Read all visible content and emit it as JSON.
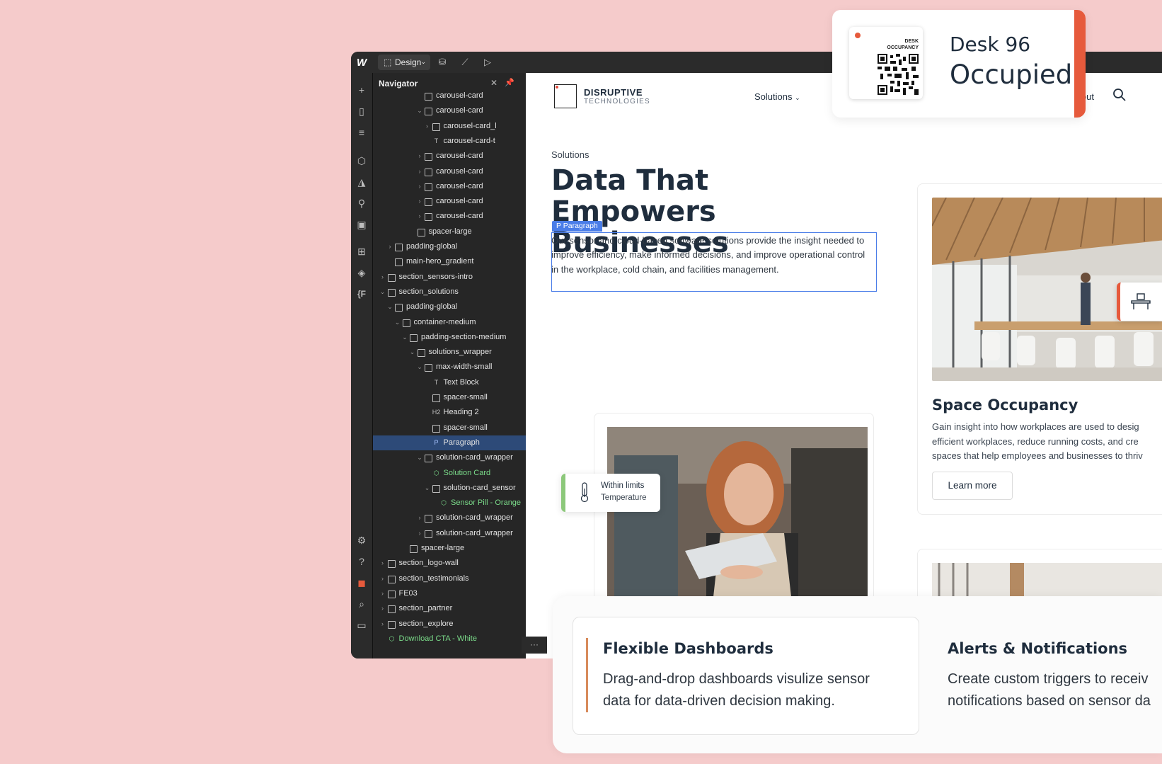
{
  "editor": {
    "mode_label": "Design",
    "navigator": {
      "title": "Navigator",
      "tree": [
        {
          "label": "carousel-card",
          "depth": 6,
          "arrow": "",
          "icon": "box"
        },
        {
          "label": "carousel-card",
          "depth": 6,
          "arrow": "⌄",
          "icon": "box"
        },
        {
          "label": "carousel-card_l",
          "depth": 7,
          "arrow": "›",
          "icon": "box"
        },
        {
          "label": "carousel-card-t",
          "depth": 7,
          "arrow": "",
          "icon": "T"
        },
        {
          "label": "carousel-card",
          "depth": 6,
          "arrow": "›",
          "icon": "box"
        },
        {
          "label": "carousel-card",
          "depth": 6,
          "arrow": "›",
          "icon": "box"
        },
        {
          "label": "carousel-card",
          "depth": 6,
          "arrow": "›",
          "icon": "box"
        },
        {
          "label": "carousel-card",
          "depth": 6,
          "arrow": "›",
          "icon": "box"
        },
        {
          "label": "carousel-card",
          "depth": 6,
          "arrow": "›",
          "icon": "box"
        },
        {
          "label": "spacer-large",
          "depth": 5,
          "arrow": "",
          "icon": "box"
        },
        {
          "label": "padding-global",
          "depth": 2,
          "arrow": "›",
          "icon": "box"
        },
        {
          "label": "main-hero_gradient",
          "depth": 2,
          "arrow": "",
          "icon": "box"
        },
        {
          "label": "section_sensors-intro",
          "depth": 1,
          "arrow": "›",
          "icon": "box"
        },
        {
          "label": "section_solutions",
          "depth": 1,
          "arrow": "⌄",
          "icon": "box"
        },
        {
          "label": "padding-global",
          "depth": 2,
          "arrow": "⌄",
          "icon": "box"
        },
        {
          "label": "container-medium",
          "depth": 3,
          "arrow": "⌄",
          "icon": "box"
        },
        {
          "label": "padding-section-medium",
          "depth": 4,
          "arrow": "⌄",
          "icon": "box"
        },
        {
          "label": "solutions_wrapper",
          "depth": 5,
          "arrow": "⌄",
          "icon": "box"
        },
        {
          "label": "max-width-small",
          "depth": 6,
          "arrow": "⌄",
          "icon": "box"
        },
        {
          "label": "Text Block",
          "depth": 7,
          "arrow": "",
          "icon": "T"
        },
        {
          "label": "spacer-small",
          "depth": 7,
          "arrow": "",
          "icon": "box"
        },
        {
          "label": "Heading 2",
          "depth": 7,
          "arrow": "",
          "icon": "H2"
        },
        {
          "label": "spacer-small",
          "depth": 7,
          "arrow": "",
          "icon": "box"
        },
        {
          "label": "Paragraph",
          "depth": 7,
          "arrow": "",
          "icon": "P",
          "selected": true
        },
        {
          "label": "solution-card_wrapper",
          "depth": 6,
          "arrow": "⌄",
          "icon": "box"
        },
        {
          "label": "Solution Card",
          "depth": 7,
          "arrow": "",
          "icon": "comp",
          "component": true
        },
        {
          "label": "solution-card_sensor",
          "depth": 7,
          "arrow": "⌄",
          "icon": "box"
        },
        {
          "label": "Sensor Pill - Orange",
          "depth": 8,
          "arrow": "",
          "icon": "comp",
          "component": true
        },
        {
          "label": "solution-card_wrapper",
          "depth": 6,
          "arrow": "›",
          "icon": "box"
        },
        {
          "label": "solution-card_wrapper",
          "depth": 6,
          "arrow": "›",
          "icon": "box"
        },
        {
          "label": "spacer-large",
          "depth": 4,
          "arrow": "",
          "icon": "box"
        },
        {
          "label": "section_logo-wall",
          "depth": 1,
          "arrow": "›",
          "icon": "box"
        },
        {
          "label": "section_testimonials",
          "depth": 1,
          "arrow": "›",
          "icon": "box"
        },
        {
          "label": "FE03",
          "depth": 1,
          "arrow": "›",
          "icon": "box"
        },
        {
          "label": "section_partner",
          "depth": 1,
          "arrow": "›",
          "icon": "box"
        },
        {
          "label": "section_explore",
          "depth": 1,
          "arrow": "›",
          "icon": "box"
        },
        {
          "label": "Download CTA - White",
          "depth": 1,
          "arrow": "",
          "icon": "comp",
          "component": true
        }
      ]
    },
    "more_label": "···"
  },
  "site": {
    "logo_line1": "DISRUPTIVE",
    "logo_line2": "TECHNOLOGIES",
    "nav_solutions": "Solutions",
    "nav_about": "About",
    "eyebrow": "Solutions",
    "hero_title": "Data That Empowers Businesses",
    "paragraph_tag": "P  Paragraph",
    "paragraph": "Our sensor and cloud-based software solutions provide the insight needed to improve efficiency, make informed decisions, and improve operational control in the workplace, cold chain, and facilities management.",
    "space_occupancy": {
      "title": "Space Occupancy",
      "lines": [
        "Gain insight into how workplaces are used to desig",
        "efficient workplaces, reduce running costs, and cre",
        "spaces that help employees and businesses to thriv"
      ],
      "button": "Learn more"
    },
    "temp_pill": {
      "line1": "Within limits",
      "line2": "Temperature"
    }
  },
  "features": {
    "card1_title": "Flexible Dashboards",
    "card1_text": "Drag-and-drop dashboards visulize sensor data for data-driven decision making.",
    "card2_title": "Alerts & Notifications",
    "card2_line1": "Create custom triggers to receiv",
    "card2_line2": "notifications based on sensor da"
  },
  "desk_card": {
    "qr_label": "DESK OCCUPANCY",
    "desk_name": "Desk 96",
    "status": "Occupied"
  },
  "colors": {
    "background": "#f5cbcb",
    "accent_orange": "#e65a3c",
    "accent_green": "#8cc87a",
    "selection_blue": "#4a7de8"
  }
}
